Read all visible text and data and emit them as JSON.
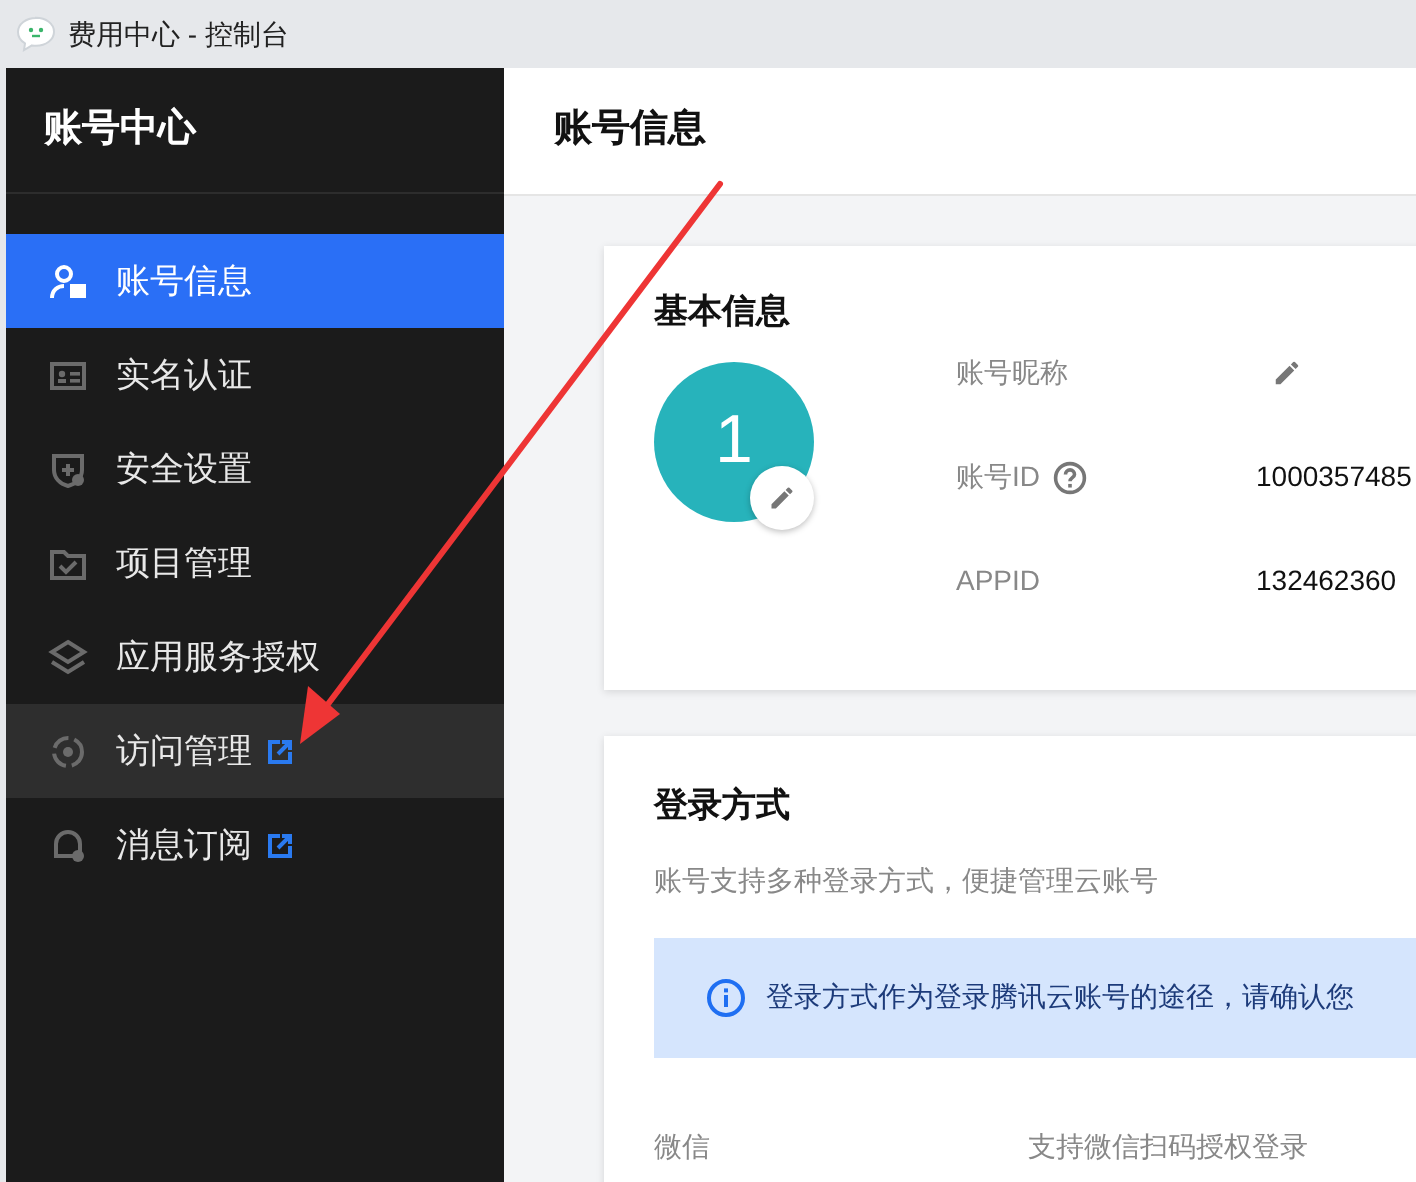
{
  "window": {
    "title": "费用中心 - 控制台"
  },
  "sidebar": {
    "title": "账号中心",
    "items": [
      {
        "label": "账号信息",
        "selected": true,
        "highlighted": false,
        "external": false
      },
      {
        "label": "实名认证",
        "selected": false,
        "highlighted": false,
        "external": false
      },
      {
        "label": "安全设置",
        "selected": false,
        "highlighted": false,
        "external": false
      },
      {
        "label": "项目管理",
        "selected": false,
        "highlighted": false,
        "external": false
      },
      {
        "label": "应用服务授权",
        "selected": false,
        "highlighted": false,
        "external": false
      },
      {
        "label": "访问管理",
        "selected": false,
        "highlighted": true,
        "external": true
      },
      {
        "label": "消息订阅",
        "selected": false,
        "highlighted": false,
        "external": true
      }
    ]
  },
  "page": {
    "title": "账号信息"
  },
  "basic_info": {
    "title": "基本信息",
    "avatar": {
      "initial": "1"
    },
    "fields": [
      {
        "label": "账号昵称",
        "kind": "editable"
      },
      {
        "label": "账号ID",
        "kind": "help",
        "value": "1000357485"
      },
      {
        "label": "APPID",
        "kind": "plain",
        "value": "132462360"
      }
    ]
  },
  "login_methods": {
    "title": "登录方式",
    "description": "账号支持多种登录方式，便捷管理云账号",
    "notice": "登录方式作为登录腾讯云账号的途径，请确认您",
    "rows": [
      {
        "label": "微信",
        "value": "支持微信扫码授权登录"
      }
    ]
  }
}
